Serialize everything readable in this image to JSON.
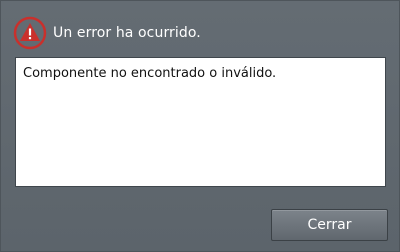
{
  "dialog": {
    "title": "Un error ha ocurrido.",
    "icon": "error-warning-icon",
    "message": "Componente no encontrado o inválido.",
    "close_label": "Cerrar"
  },
  "colors": {
    "background": "#5f676e",
    "icon_red": "#c9302c",
    "message_bg": "#ffffff",
    "button_top": "#7c838a",
    "button_bottom": "#60676e"
  }
}
